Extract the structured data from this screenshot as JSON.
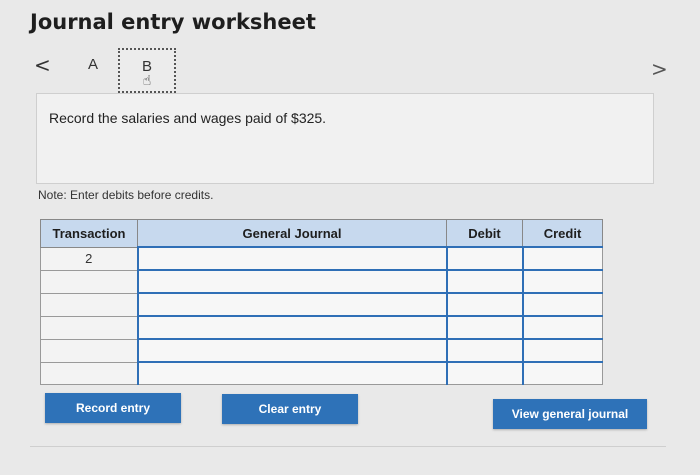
{
  "title": "Journal entry worksheet",
  "nav": {
    "prev": "<",
    "next": ">"
  },
  "tabs": [
    {
      "label": "A"
    },
    {
      "label": "B"
    }
  ],
  "instruction": "Record the salaries and wages paid of $325.",
  "note": "Note: Enter debits before credits.",
  "table": {
    "headers": {
      "transaction": "Transaction",
      "account": "General Journal",
      "debit": "Debit",
      "credit": "Credit"
    },
    "rows": [
      {
        "transaction": "2",
        "account": "",
        "debit": "",
        "credit": ""
      },
      {
        "transaction": "",
        "account": "",
        "debit": "",
        "credit": ""
      },
      {
        "transaction": "",
        "account": "",
        "debit": "",
        "credit": ""
      },
      {
        "transaction": "",
        "account": "",
        "debit": "",
        "credit": ""
      },
      {
        "transaction": "",
        "account": "",
        "debit": "",
        "credit": ""
      },
      {
        "transaction": "",
        "account": "",
        "debit": "",
        "credit": ""
      }
    ]
  },
  "buttons": {
    "record": "Record entry",
    "clear": "Clear entry",
    "view": "View general journal"
  },
  "colors": {
    "button": "#2e72b8",
    "header": "#c7d9ee",
    "input_border": "#2f6fb6"
  },
  "icons": {
    "cursor": "hand-pointer-icon"
  }
}
